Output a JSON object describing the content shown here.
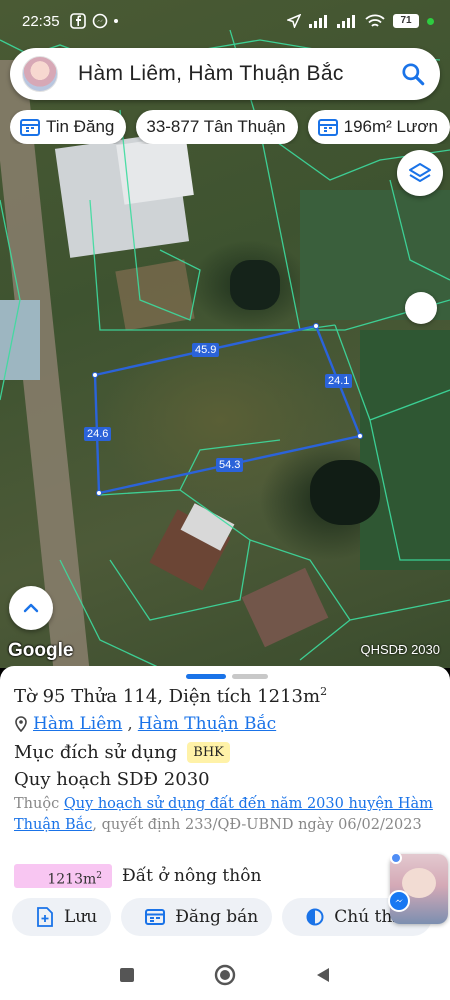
{
  "status_bar": {
    "time": "22:35",
    "battery": "71"
  },
  "search": {
    "query": "Hàm Liêm, Hàm Thuận Bắc"
  },
  "chips": [
    {
      "label": "Tin Đăng",
      "icon": "calendar-icon"
    },
    {
      "label": "33-877 Tân Thuận",
      "icon": ""
    },
    {
      "label": "196m² Lươn",
      "icon": "calendar-icon"
    }
  ],
  "map": {
    "logo": "Google",
    "layer_label": "QHSDĐ 2030",
    "measurements": {
      "top": "45.9",
      "right": "24.1",
      "left": "24.6",
      "bottom": "54.3"
    },
    "colors": {
      "parcel_outline": "#2b63d9",
      "parcel_grid": "#3ddc9f"
    }
  },
  "sheet": {
    "title_prefix": "Tờ 95 Thửa 114, Diện tích 1213m",
    "title_sup": "2",
    "commune": "Hàm Liêm",
    "district": "Hàm Thuận Bắc",
    "purpose_label": "Mục đích sử dụng",
    "purpose_code": "BHK",
    "plan_title": "Quy hoạch SDĐ 2030",
    "plan_prefix": "Thuộc",
    "plan_link": "Quy hoạch sử dụng đất đến năm 2030 huyện Hàm Thuận Bắc",
    "plan_suffix": ", quyết định 233/QĐ-UBND ngày 06/02/2023",
    "area_value": "1213m",
    "area_sup": "2",
    "area_label": "Đất ở nông thôn",
    "area_color": "#f8c6f2"
  },
  "actions": [
    {
      "label": "Lưu",
      "icon": "save-add-icon"
    },
    {
      "label": "Đăng bán",
      "icon": "listing-icon"
    },
    {
      "label": "Chú thích",
      "icon": "legend-icon"
    }
  ]
}
